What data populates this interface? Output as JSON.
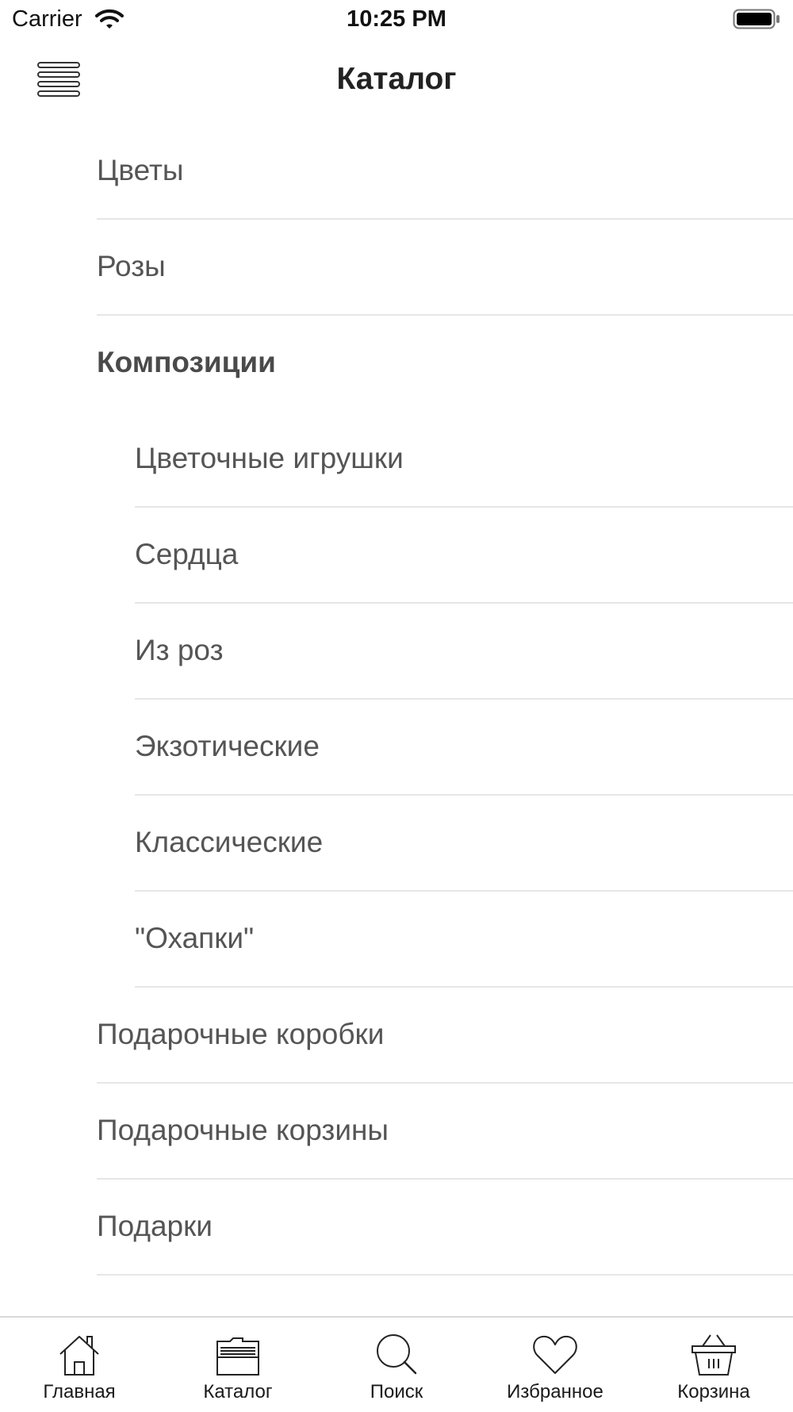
{
  "status_bar": {
    "carrier": "Carrier",
    "time": "10:25 PM"
  },
  "nav": {
    "title": "Каталог"
  },
  "catalog": {
    "items": [
      {
        "label": "Цветы"
      },
      {
        "label": "Розы"
      },
      {
        "label": "Композиции",
        "expanded": true
      },
      {
        "label": "Цветочные игрушки",
        "indent": 1
      },
      {
        "label": "Сердца",
        "indent": 1
      },
      {
        "label": "Из роз",
        "indent": 1
      },
      {
        "label": "Экзотические",
        "indent": 1
      },
      {
        "label": "Классические",
        "indent": 1
      },
      {
        "label": "\"Охапки\"",
        "indent": 1
      },
      {
        "label": "Подарочные коробки"
      },
      {
        "label": "Подарочные корзины"
      },
      {
        "label": "Подарки"
      }
    ]
  },
  "tabbar": {
    "tabs": [
      {
        "label": "Главная",
        "icon": "home-icon"
      },
      {
        "label": "Каталог",
        "icon": "folder-icon",
        "selected": true
      },
      {
        "label": "Поиск",
        "icon": "search-icon"
      },
      {
        "label": "Избранное",
        "icon": "heart-icon"
      },
      {
        "label": "Корзина",
        "icon": "basket-icon"
      }
    ]
  }
}
